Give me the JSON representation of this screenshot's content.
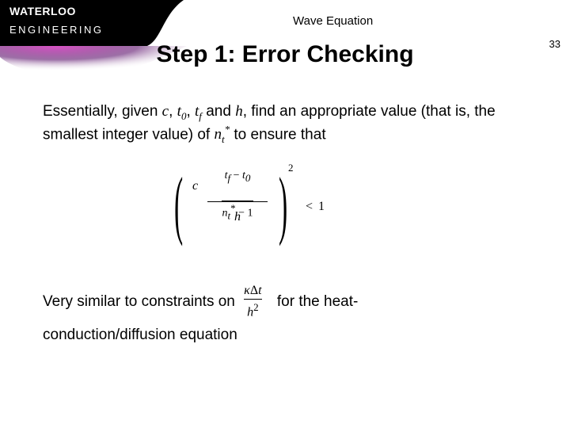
{
  "brand": {
    "top": "WATERLOO",
    "bottom": "ENGINEERING"
  },
  "topic": "Wave Equation",
  "page_number": "33",
  "title": "Step 1:  Error Checking",
  "para1_a": "Essentially, given ",
  "sym": {
    "c": "c",
    "t0": "t",
    "t0_sub": "0",
    "tf": "t",
    "tf_sub": "f",
    "h": "h",
    "nt": "n",
    "nt_sub": "t",
    "star": "*",
    "minus": " − ",
    "kappa": "κ",
    "delta": "Δ",
    "lt": "<",
    "one": "1",
    "sq": "2",
    "minus1": "1"
  },
  "para1_b": ", ",
  "para1_c": ", ",
  "para1_d": " and ",
  "para1_e": ", find an appropriate value (that is, the smallest integer value) of ",
  "para1_f": " to ensure that",
  "line2_a": "Very similar to constraints on",
  "line2_b": "for the heat-",
  "line3": "conduction/diffusion equation"
}
